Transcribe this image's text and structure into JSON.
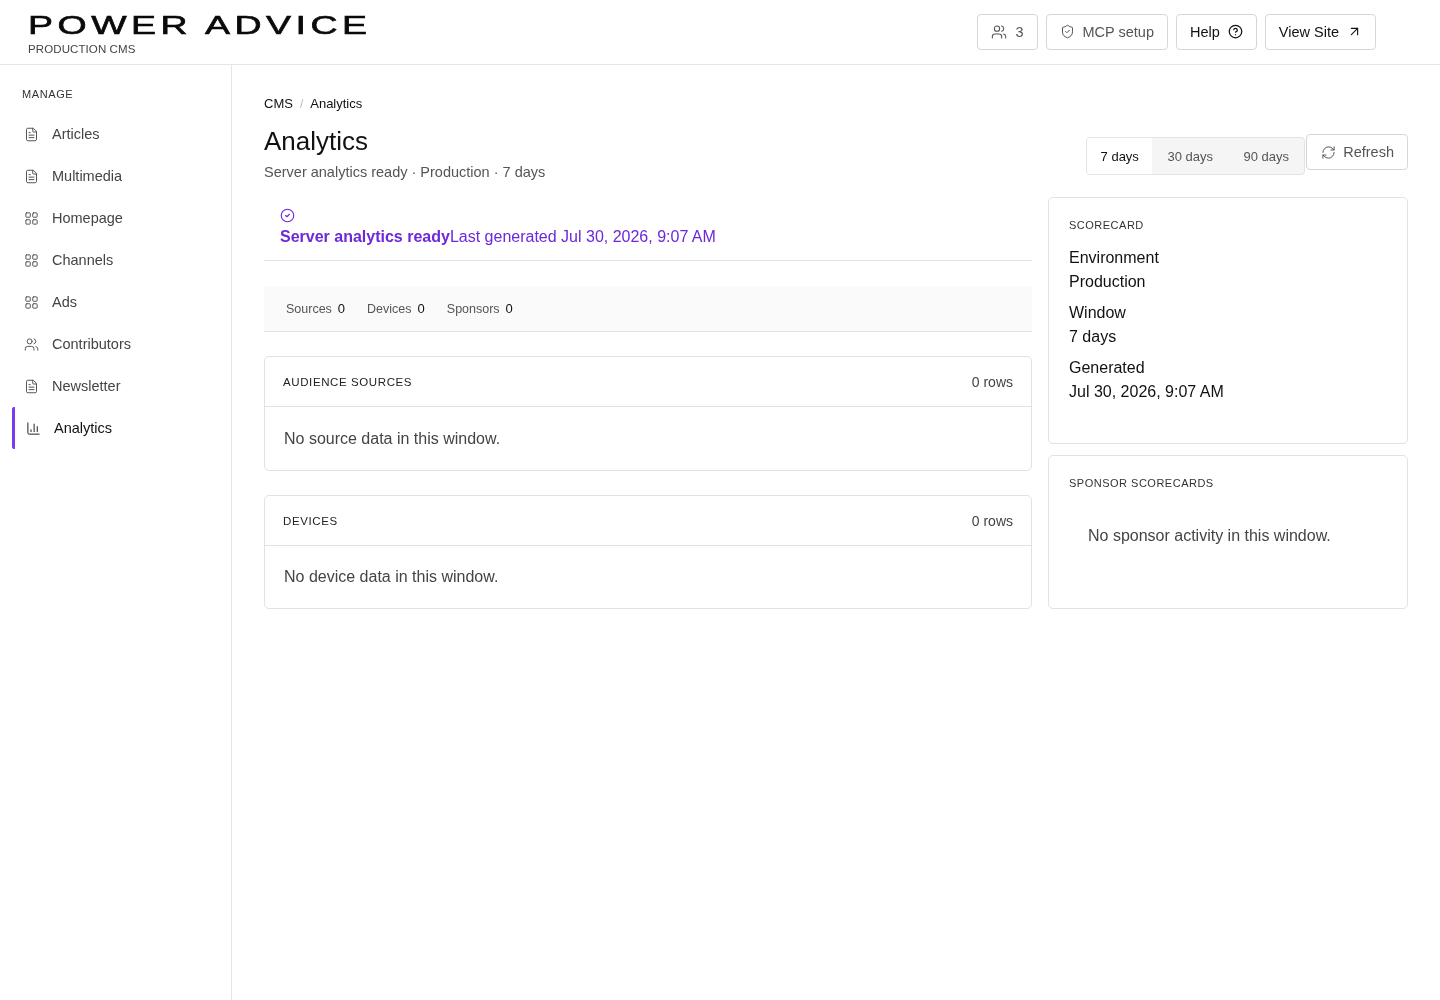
{
  "header": {
    "logo": "POWER ADVICE",
    "environment": "PRODUCTION CMS",
    "buttons": [
      {
        "kind": "users",
        "label": "3"
      },
      {
        "kind": "shield",
        "label": "MCP setup"
      },
      {
        "kind": "help",
        "label": "Help"
      },
      {
        "kind": "external",
        "label": "View Site"
      }
    ]
  },
  "sidebar": {
    "section": "MANAGE",
    "items": [
      {
        "kind": "document",
        "label": "Articles",
        "selected": false
      },
      {
        "kind": "document",
        "label": "Multimedia",
        "selected": false
      },
      {
        "kind": "grid",
        "label": "Homepage",
        "selected": false
      },
      {
        "kind": "grid",
        "label": "Channels",
        "selected": false
      },
      {
        "kind": "grid",
        "label": "Ads",
        "selected": false
      },
      {
        "kind": "users",
        "label": "Contributors",
        "selected": false
      },
      {
        "kind": "document",
        "label": "Newsletter",
        "selected": false
      },
      {
        "kind": "chart",
        "label": "Analytics",
        "selected": true
      }
    ]
  },
  "breadcrumb": {
    "items": [
      "CMS",
      "Analytics"
    ],
    "separator": "/"
  },
  "page": {
    "title": "Analytics",
    "subtitle": "Server analytics ready · Production · 7 days"
  },
  "ranges": [
    {
      "label": "7 days",
      "selected": true
    },
    {
      "label": "30 days",
      "selected": false
    },
    {
      "label": "90 days",
      "selected": false
    }
  ],
  "refresh": {
    "label": "Refresh"
  },
  "status": {
    "text": "**Server analytics ready**Last generated Jul 30, 2026, 9:07 AM"
  },
  "stats": [
    {
      "label": "Sources",
      "value": "0"
    },
    {
      "label": "Devices",
      "value": "0"
    },
    {
      "label": "Sponsors",
      "value": "0"
    }
  ],
  "panels": [
    {
      "title": "AUDIENCE SOURCES",
      "count": "0 rows",
      "empty": "No source data in this window."
    },
    {
      "title": "DEVICES",
      "count": "0 rows",
      "empty": "No device data in this window."
    }
  ],
  "scorecard": {
    "title": "SCORECARD",
    "fields": [
      {
        "label": "Environment",
        "value": "Production"
      },
      {
        "label": "Window",
        "value": "7 days"
      },
      {
        "label": "Generated",
        "value": "Jul 30, 2026, 9:07 AM"
      }
    ]
  },
  "sponsor_scorecards": {
    "title": "SPONSOR SCORECARDS",
    "empty": "No sponsor activity in this window."
  }
}
